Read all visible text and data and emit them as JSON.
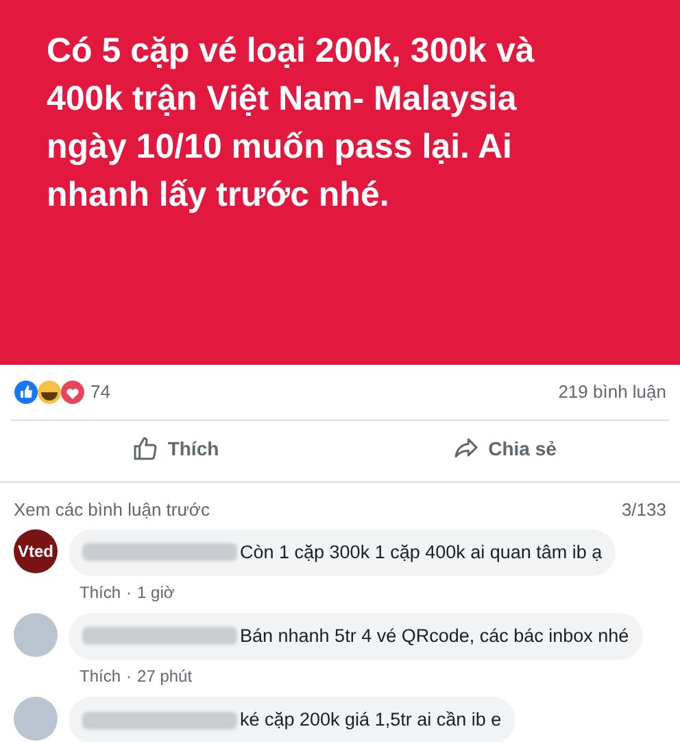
{
  "post": {
    "text": "Có 5 cặp vé loại 200k, 300k và 400k trận Việt Nam- Malaysia ngày 10/10 muốn pass lại. Ai nhanh lấy trước nhé."
  },
  "reactions": {
    "count": "74",
    "comments": "219 bình luận"
  },
  "actions": [
    {
      "kind": "like",
      "label": "Thích"
    },
    {
      "kind": "share",
      "label": "Chia sẻ"
    }
  ],
  "comments_header": {
    "link": "Xem các bình luận trước",
    "count": "3/133"
  },
  "comments": [
    {
      "kind": "logo",
      "avatar_text": "Vted",
      "text": "Còn 1 cặp 300k 1 cặp 400k ai quan tâm ib ạ",
      "like": "Thích",
      "separator": "·",
      "time": "1 giờ"
    },
    {
      "kind": "photo",
      "text": "Bán nhanh 5tr 4 vé QRcode, các bác inbox nhé",
      "like": "Thích",
      "separator": "·",
      "time": "27 phút"
    },
    {
      "kind": "photo",
      "text": "ké cặp 200k giá 1,5tr ai cần ib e"
    }
  ]
}
